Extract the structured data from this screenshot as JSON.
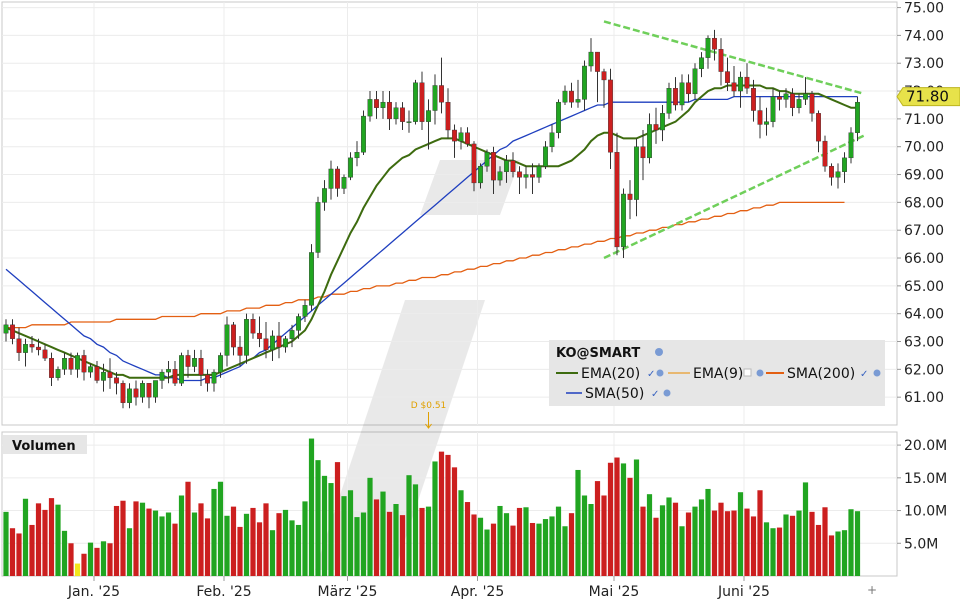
{
  "colors": {
    "up": "#21a521",
    "down": "#cc1f1f",
    "ema20": "#3d6b0f",
    "ema9": "#e8a84a",
    "sma200": "#e35f12",
    "sma50": "#1f3fbf",
    "trend": "#6fcf5a",
    "price_tag": "#e7e24a",
    "dividend": "#e0a000"
  },
  "legend": {
    "symbol": "KO@SMART",
    "items": [
      {
        "key": "ema20",
        "label": "EMA(20)"
      },
      {
        "key": "ema9",
        "label": "EMA(9)"
      },
      {
        "key": "sma200",
        "label": "SMA(200)"
      },
      {
        "key": "sma50",
        "label": "SMA(50)"
      }
    ]
  },
  "volume_title": "Volumen",
  "last_price": "71.80",
  "dividend_label": "D $0.51",
  "chart_data": {
    "type": "candlestick",
    "price_axis": {
      "min": 60.0,
      "max": 75.2,
      "ticks": [
        "75.00",
        "74.00",
        "73.00",
        "72.00",
        "71.00",
        "70.00",
        "69.00",
        "68.00",
        "67.00",
        "66.00",
        "65.00",
        "64.00",
        "63.00",
        "62.00",
        "61.00"
      ]
    },
    "volume_axis": {
      "min": 0,
      "max": 22,
      "ticks": [
        "20.0M",
        "15.0M",
        "10.0M",
        "5.0M"
      ]
    },
    "x_labels": [
      "Jan. '25",
      "Feb. '25",
      "März '25",
      "Apr. '25",
      "Mai '25",
      "Juni '25"
    ],
    "month_start_index": [
      14,
      34,
      53,
      73,
      94,
      114
    ],
    "candles": [
      [
        63.3,
        63.8,
        63.0,
        63.6,
        9.8
      ],
      [
        63.6,
        63.8,
        62.9,
        63.1,
        7.3
      ],
      [
        63.1,
        63.5,
        62.3,
        62.6,
        6.5
      ],
      [
        62.6,
        63.1,
        62.1,
        62.9,
        11.8
      ],
      [
        62.9,
        63.2,
        62.6,
        62.8,
        7.8
      ],
      [
        62.8,
        63.1,
        62.5,
        62.7,
        11.1
      ],
      [
        62.7,
        62.9,
        62.3,
        62.4,
        10.1
      ],
      [
        62.4,
        62.6,
        61.4,
        61.7,
        11.9
      ],
      [
        61.7,
        62.1,
        61.6,
        62.0,
        10.9
      ],
      [
        62.0,
        62.6,
        61.8,
        62.4,
        6.9
      ],
      [
        62.4,
        62.6,
        61.8,
        62.0,
        5.0
      ],
      [
        62.0,
        62.6,
        61.7,
        62.5,
        1.9
      ],
      [
        62.5,
        62.7,
        61.6,
        61.9,
        3.4
      ],
      [
        61.9,
        62.2,
        61.7,
        62.1,
        5.1
      ],
      [
        62.1,
        62.3,
        61.5,
        61.6,
        4.3
      ],
      [
        61.6,
        62.2,
        61.2,
        61.9,
        5.3
      ],
      [
        61.9,
        62.4,
        61.3,
        61.7,
        5.0
      ],
      [
        61.7,
        61.9,
        61.1,
        61.5,
        10.7
      ],
      [
        61.5,
        61.6,
        60.6,
        60.8,
        11.5
      ],
      [
        60.8,
        61.5,
        60.6,
        61.3,
        7.3
      ],
      [
        61.3,
        61.6,
        60.7,
        61.0,
        11.4
      ],
      [
        61.0,
        61.6,
        60.8,
        61.5,
        11.2
      ],
      [
        61.5,
        61.5,
        60.6,
        61.0,
        10.3
      ],
      [
        61.0,
        61.6,
        60.8,
        61.6,
        10.0
      ],
      [
        61.6,
        62.0,
        61.3,
        61.9,
        9.1
      ],
      [
        61.9,
        62.3,
        61.5,
        62.0,
        9.7
      ],
      [
        62.0,
        62.3,
        61.4,
        61.5,
        8.0
      ],
      [
        61.5,
        62.6,
        61.4,
        62.5,
        12.3
      ],
      [
        62.5,
        62.7,
        61.7,
        62.1,
        14.4
      ],
      [
        62.1,
        62.7,
        61.9,
        62.4,
        9.7
      ],
      [
        62.4,
        62.7,
        61.4,
        61.8,
        11.1
      ],
      [
        61.8,
        62.0,
        61.2,
        61.5,
        8.8
      ],
      [
        61.5,
        62.0,
        61.2,
        61.9,
        13.3
      ],
      [
        61.9,
        62.6,
        61.7,
        62.5,
        14.4
      ],
      [
        62.5,
        63.9,
        62.1,
        63.6,
        9.2
      ],
      [
        63.6,
        63.7,
        62.5,
        62.8,
        10.6
      ],
      [
        62.8,
        63.2,
        62.1,
        62.5,
        7.5
      ],
      [
        62.5,
        64.0,
        62.2,
        63.8,
        9.5
      ],
      [
        63.8,
        64.0,
        63.1,
        63.3,
        10.4
      ],
      [
        63.3,
        63.9,
        62.8,
        63.1,
        8.2
      ],
      [
        63.1,
        63.7,
        62.4,
        62.7,
        11.1
      ],
      [
        62.7,
        63.4,
        62.3,
        63.2,
        7.0
      ],
      [
        63.2,
        63.7,
        62.4,
        62.8,
        9.6
      ],
      [
        62.8,
        63.2,
        62.6,
        63.1,
        10.1
      ],
      [
        63.1,
        63.6,
        62.8,
        63.4,
        8.5
      ],
      [
        63.4,
        64.0,
        63.1,
        63.9,
        7.8
      ],
      [
        63.9,
        64.5,
        63.7,
        64.3,
        11.4
      ],
      [
        64.3,
        66.5,
        64.1,
        66.2,
        21.0
      ],
      [
        66.2,
        68.2,
        66.0,
        68.0,
        17.7
      ],
      [
        68.0,
        68.8,
        67.7,
        68.5,
        15.3
      ],
      [
        68.5,
        69.5,
        68.1,
        69.2,
        14.2
      ],
      [
        69.2,
        69.3,
        68.2,
        68.5,
        17.4
      ],
      [
        68.5,
        69.0,
        68.3,
        68.9,
        12.2
      ],
      [
        68.9,
        69.8,
        68.8,
        69.6,
        13.1
      ],
      [
        69.6,
        70.2,
        69.3,
        69.8,
        9.0
      ],
      [
        69.8,
        71.3,
        69.7,
        71.1,
        9.7
      ],
      [
        71.1,
        72.0,
        70.9,
        71.7,
        15.0
      ],
      [
        71.7,
        72.0,
        71.0,
        71.4,
        11.7
      ],
      [
        71.4,
        72.0,
        71.0,
        71.6,
        12.9
      ],
      [
        71.6,
        72.0,
        70.6,
        71.0,
        9.8
      ],
      [
        71.0,
        71.6,
        70.8,
        71.4,
        11.0
      ],
      [
        71.4,
        71.6,
        70.6,
        70.9,
        9.3
      ],
      [
        70.9,
        71.3,
        70.5,
        70.9,
        15.4
      ],
      [
        70.9,
        72.4,
        70.8,
        72.3,
        14.0
      ],
      [
        72.3,
        72.7,
        70.6,
        70.9,
        10.4
      ],
      [
        70.9,
        71.7,
        69.9,
        71.3,
        10.6
      ],
      [
        71.3,
        72.6,
        70.8,
        72.2,
        17.5
      ],
      [
        72.2,
        73.2,
        71.2,
        71.6,
        19.0
      ],
      [
        71.6,
        72.1,
        70.3,
        70.6,
        18.5
      ],
      [
        70.6,
        70.8,
        69.6,
        70.2,
        16.6
      ],
      [
        70.2,
        70.7,
        69.9,
        70.5,
        13.1
      ],
      [
        70.5,
        70.7,
        70.0,
        70.1,
        11.3
      ],
      [
        70.1,
        70.2,
        68.4,
        68.7,
        9.4
      ],
      [
        68.7,
        69.4,
        68.5,
        69.3,
        8.9
      ],
      [
        69.3,
        69.9,
        69.1,
        69.8,
        7.1
      ],
      [
        69.8,
        70.0,
        68.3,
        68.8,
        8.0
      ],
      [
        68.8,
        69.3,
        68.6,
        69.1,
        10.7
      ],
      [
        69.1,
        69.7,
        68.7,
        69.5,
        9.6
      ],
      [
        69.5,
        69.8,
        68.9,
        69.1,
        7.7
      ],
      [
        69.1,
        69.3,
        68.3,
        68.9,
        10.4
      ],
      [
        68.9,
        69.3,
        68.5,
        69.0,
        10.5
      ],
      [
        69.0,
        69.4,
        68.3,
        68.9,
        8.1
      ],
      [
        68.9,
        69.4,
        68.7,
        69.3,
        8.0
      ],
      [
        69.3,
        70.2,
        69.2,
        70.0,
        8.7
      ],
      [
        70.0,
        70.8,
        69.8,
        70.5,
        9.1
      ],
      [
        70.5,
        71.7,
        70.3,
        71.6,
        10.6
      ],
      [
        71.6,
        72.2,
        71.5,
        72.0,
        7.6
      ],
      [
        72.0,
        72.3,
        71.4,
        71.6,
        9.6
      ],
      [
        71.6,
        72.4,
        71.4,
        71.7,
        16.2
      ],
      [
        71.7,
        73.1,
        71.3,
        72.9,
        12.3
      ],
      [
        72.9,
        73.9,
        72.7,
        73.4,
        11.0
      ],
      [
        73.4,
        73.4,
        71.6,
        72.7,
        14.5
      ],
      [
        72.7,
        72.8,
        71.4,
        72.4,
        12.3
      ],
      [
        72.4,
        72.8,
        69.2,
        69.8,
        17.3
      ],
      [
        69.8,
        70.5,
        66.1,
        66.4,
        18.1
      ],
      [
        66.4,
        68.5,
        66.0,
        68.3,
        17.2
      ],
      [
        68.3,
        68.8,
        67.4,
        68.1,
        15.0
      ],
      [
        68.1,
        70.3,
        67.5,
        70.0,
        17.8
      ],
      [
        70.0,
        70.6,
        68.8,
        69.6,
        10.6
      ],
      [
        69.6,
        71.2,
        69.4,
        70.8,
        12.5
      ],
      [
        70.8,
        71.4,
        70.1,
        70.6,
        8.9
      ],
      [
        70.6,
        71.5,
        70.2,
        71.2,
        10.8
      ],
      [
        71.2,
        72.3,
        71.0,
        72.1,
        12.0
      ],
      [
        72.1,
        72.5,
        71.3,
        71.5,
        11.2
      ],
      [
        71.5,
        72.6,
        71.3,
        72.3,
        7.6
      ],
      [
        72.3,
        72.6,
        71.6,
        71.9,
        9.7
      ],
      [
        71.9,
        73.0,
        71.7,
        72.8,
        10.6
      ],
      [
        72.8,
        73.4,
        72.5,
        73.2,
        11.7
      ],
      [
        73.2,
        74.0,
        72.8,
        73.9,
        13.3
      ],
      [
        73.9,
        74.2,
        73.1,
        73.5,
        10.0
      ],
      [
        73.5,
        73.9,
        72.2,
        72.7,
        11.2
      ],
      [
        72.7,
        73.2,
        72.0,
        72.3,
        9.9
      ],
      [
        72.3,
        72.9,
        71.8,
        72.0,
        10.0
      ],
      [
        72.0,
        72.7,
        71.4,
        72.5,
        12.8
      ],
      [
        72.5,
        73.0,
        71.9,
        72.1,
        10.3
      ],
      [
        72.1,
        72.4,
        70.9,
        71.3,
        9.1
      ],
      [
        71.3,
        71.8,
        70.3,
        70.8,
        13.1
      ],
      [
        70.8,
        71.4,
        70.4,
        70.9,
        8.2
      ],
      [
        70.9,
        72.1,
        70.7,
        71.8,
        7.3
      ],
      [
        71.8,
        72.0,
        71.3,
        71.7,
        7.4
      ],
      [
        71.7,
        72.1,
        71.4,
        71.9,
        9.4
      ],
      [
        71.9,
        72.1,
        71.1,
        71.4,
        9.2
      ],
      [
        71.4,
        71.9,
        71.2,
        71.7,
        10.0
      ],
      [
        71.7,
        72.5,
        71.5,
        71.9,
        14.3
      ],
      [
        71.9,
        72.0,
        70.9,
        71.2,
        9.8
      ],
      [
        71.2,
        71.3,
        69.8,
        70.2,
        7.8
      ],
      [
        70.2,
        70.4,
        69.1,
        69.3,
        10.5
      ],
      [
        69.3,
        69.4,
        68.6,
        68.9,
        6.2
      ],
      [
        68.9,
        69.4,
        68.5,
        69.1,
        6.8
      ],
      [
        69.1,
        69.8,
        68.7,
        69.6,
        7.0
      ],
      [
        69.6,
        70.7,
        69.4,
        70.5,
        10.2
      ],
      [
        70.5,
        71.8,
        70.2,
        71.6,
        9.9
      ]
    ],
    "overlays": {
      "ema20": [
        63.5,
        63.4,
        63.3,
        63.2,
        63.1,
        63.0,
        62.9,
        62.8,
        62.7,
        62.6,
        62.5,
        62.4,
        62.3,
        62.2,
        62.1,
        62.0,
        61.9,
        61.8,
        61.8,
        61.7,
        61.7,
        61.7,
        61.7,
        61.7,
        61.7,
        61.7,
        61.8,
        61.8,
        61.8,
        61.8,
        61.8,
        61.8,
        61.8,
        61.9,
        62.0,
        62.1,
        62.2,
        62.3,
        62.4,
        62.5,
        62.6,
        62.7,
        62.8,
        62.9,
        63.0,
        63.2,
        63.4,
        63.8,
        64.3,
        64.8,
        65.4,
        65.9,
        66.4,
        66.9,
        67.3,
        67.8,
        68.2,
        68.6,
        68.9,
        69.2,
        69.4,
        69.6,
        69.7,
        69.9,
        70.0,
        70.1,
        70.2,
        70.3,
        70.3,
        70.3,
        70.2,
        70.1,
        70.0,
        69.9,
        69.8,
        69.7,
        69.6,
        69.5,
        69.5,
        69.4,
        69.3,
        69.3,
        69.3,
        69.3,
        69.3,
        69.3,
        69.4,
        69.5,
        69.7,
        69.9,
        70.2,
        70.4,
        70.5,
        70.5,
        70.4,
        70.3,
        70.3,
        70.3,
        70.4,
        70.5,
        70.6,
        70.7,
        70.8,
        70.9,
        71.1,
        71.3,
        71.6,
        71.8,
        72.0,
        72.1,
        72.1,
        72.2,
        72.2,
        72.2,
        72.2,
        72.2,
        72.2,
        72.1,
        72.1,
        72.0,
        72.0,
        71.9,
        71.9,
        71.9,
        71.9,
        71.9,
        71.8,
        71.7,
        71.6,
        71.5,
        71.4,
        71.4
      ],
      "sma50": [
        65.6,
        65.4,
        65.2,
        65.0,
        64.8,
        64.6,
        64.4,
        64.2,
        64.0,
        63.8,
        63.6,
        63.4,
        63.2,
        63.1,
        62.9,
        62.8,
        62.6,
        62.5,
        62.3,
        62.2,
        62.1,
        62.0,
        61.9,
        61.8,
        61.8,
        61.7,
        61.7,
        61.6,
        61.6,
        61.6,
        61.6,
        61.7,
        61.7,
        61.8,
        61.9,
        62.0,
        62.1,
        62.3,
        62.4,
        62.6,
        62.7,
        62.9,
        63.1,
        63.3,
        63.5,
        63.7,
        63.9,
        64.1,
        64.3,
        64.5,
        64.7,
        64.9,
        65.1,
        65.3,
        65.5,
        65.7,
        65.9,
        66.1,
        66.3,
        66.5,
        66.7,
        66.9,
        67.1,
        67.3,
        67.5,
        67.7,
        67.9,
        68.1,
        68.3,
        68.5,
        68.7,
        68.9,
        69.1,
        69.3,
        69.5,
        69.7,
        69.9,
        70.0,
        70.2,
        70.3,
        70.4,
        70.5,
        70.6,
        70.7,
        70.8,
        70.9,
        71.0,
        71.1,
        71.2,
        71.3,
        71.4,
        71.5,
        71.5,
        71.6,
        71.6,
        71.6,
        71.6,
        71.6,
        71.6,
        71.6,
        71.6,
        71.6,
        71.6,
        71.6,
        71.6,
        71.6,
        71.7,
        71.7,
        71.7,
        71.7,
        71.7,
        71.7,
        71.8,
        71.8,
        71.8,
        71.8,
        71.8,
        71.8,
        71.8,
        71.8,
        71.8,
        71.8,
        71.8,
        71.8,
        71.8,
        71.8,
        71.8,
        71.8,
        71.8,
        71.8,
        71.8,
        71.8
      ],
      "sma200": [
        63.5,
        63.5,
        63.5,
        63.5,
        63.6,
        63.6,
        63.6,
        63.6,
        63.6,
        63.6,
        63.7,
        63.7,
        63.7,
        63.7,
        63.7,
        63.7,
        63.7,
        63.8,
        63.8,
        63.8,
        63.8,
        63.8,
        63.8,
        63.8,
        63.9,
        63.9,
        63.9,
        63.9,
        63.9,
        63.9,
        64.0,
        64.0,
        64.0,
        64.0,
        64.1,
        64.1,
        64.1,
        64.2,
        64.2,
        64.2,
        64.3,
        64.3,
        64.3,
        64.4,
        64.4,
        64.5,
        64.5,
        64.5,
        64.6,
        64.6,
        64.7,
        64.7,
        64.7,
        64.8,
        64.8,
        64.9,
        64.9,
        65.0,
        65.0,
        65.0,
        65.1,
        65.1,
        65.2,
        65.2,
        65.3,
        65.3,
        65.3,
        65.4,
        65.4,
        65.5,
        65.5,
        65.6,
        65.6,
        65.7,
        65.7,
        65.8,
        65.8,
        65.9,
        65.9,
        66.0,
        66.0,
        66.1,
        66.1,
        66.2,
        66.2,
        66.3,
        66.3,
        66.4,
        66.4,
        66.5,
        66.5,
        66.6,
        66.6,
        66.7,
        66.7,
        66.8,
        66.8,
        66.9,
        66.9,
        67.0,
        67.0,
        67.1,
        67.1,
        67.2,
        67.2,
        67.3,
        67.3,
        67.4,
        67.4,
        67.5,
        67.5,
        67.6,
        67.6,
        67.7,
        67.7,
        67.8,
        67.8,
        67.9,
        67.9,
        68.0,
        68.0,
        68.0,
        68.0,
        68.0,
        68.0,
        68.0,
        68.0,
        68.0,
        68.0,
        68.0
      ]
    },
    "trendlines": [
      {
        "name": "upper",
        "from": [
          92,
          74.5
        ],
        "to": [
          132,
          71.9
        ]
      },
      {
        "name": "lower",
        "from": [
          92,
          66.0
        ],
        "to": [
          132,
          70.4
        ]
      }
    ],
    "dividend_index": 65
  }
}
